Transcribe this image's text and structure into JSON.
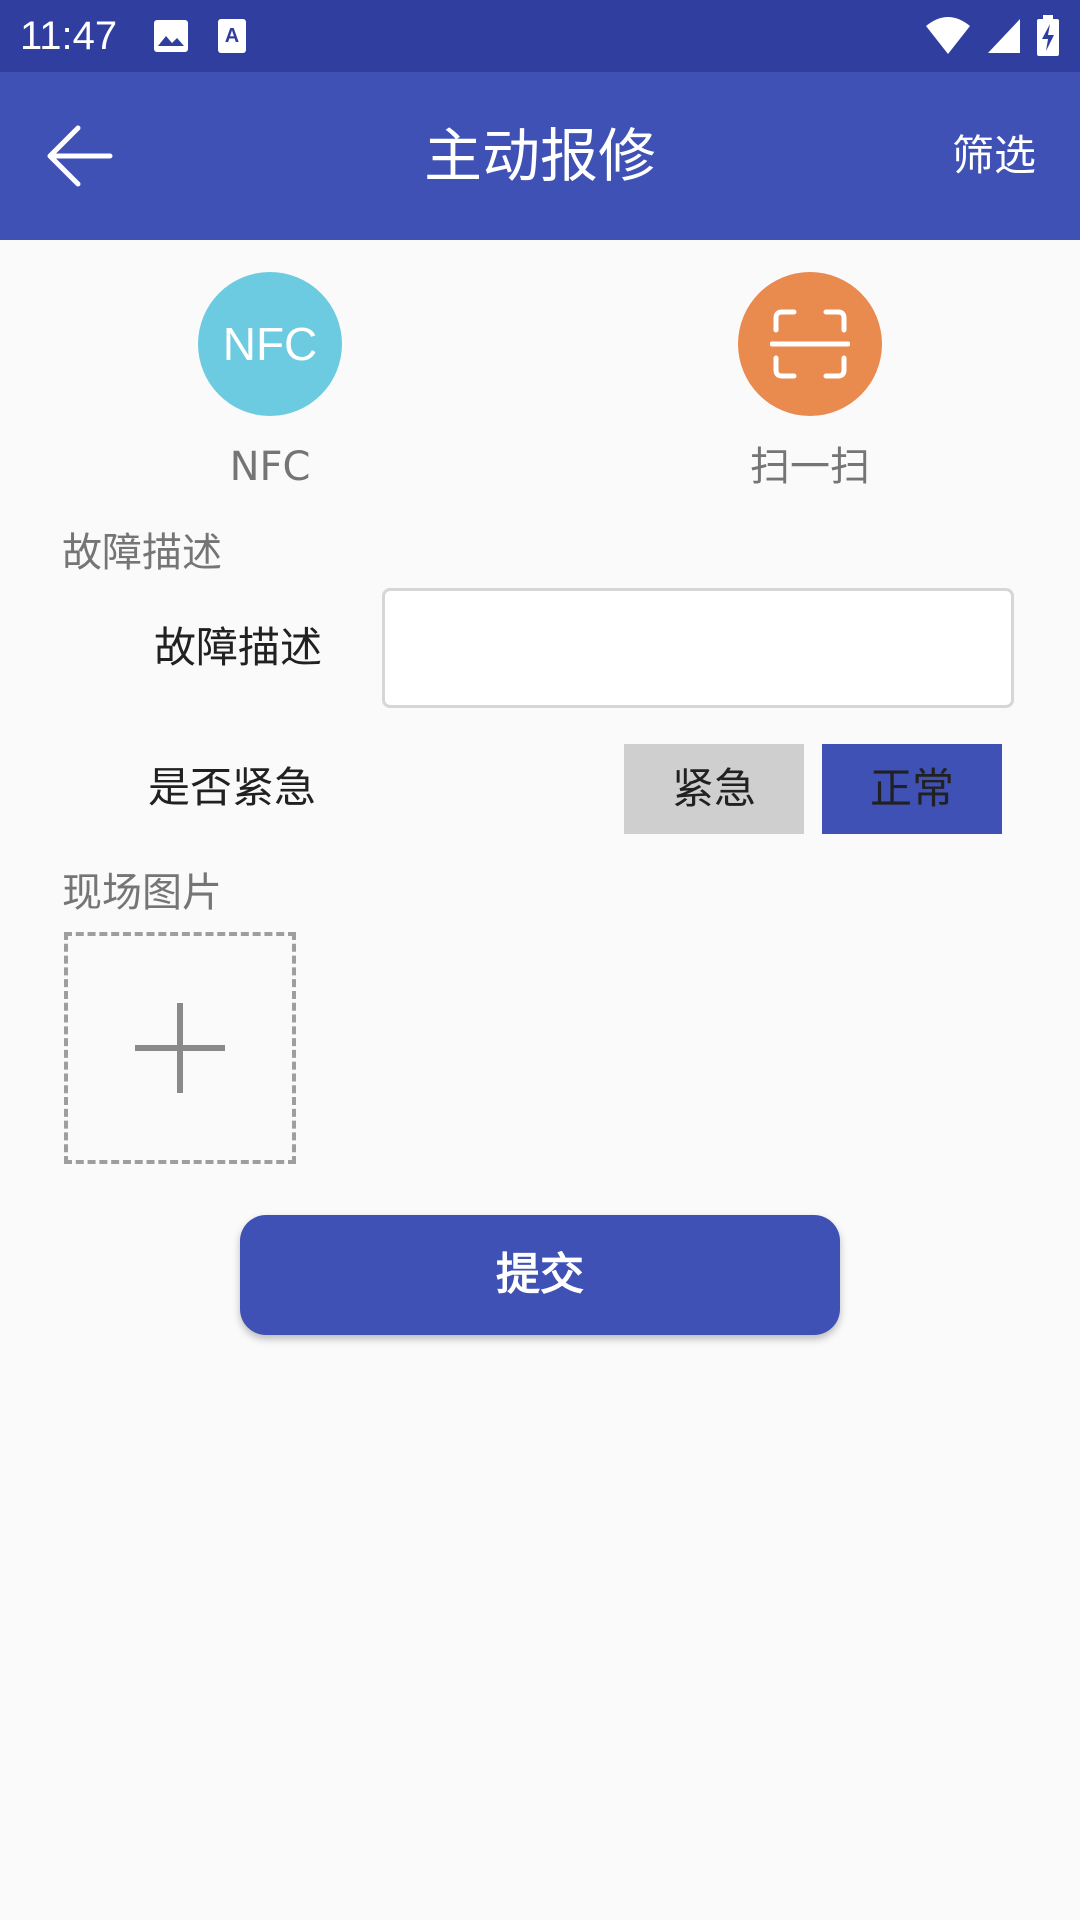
{
  "status_bar": {
    "time": "11:47",
    "icons": [
      "image-icon",
      "a-icon",
      "wifi-icon",
      "signal-icon",
      "battery-charging-icon"
    ]
  },
  "app_bar": {
    "title": "主动报修",
    "filter_label": "筛选",
    "back_icon": "arrow-left-icon"
  },
  "quick_actions": [
    {
      "label": "NFC",
      "icon_text": "NFC",
      "color": "#6ccbe0"
    },
    {
      "label": "扫一扫",
      "icon": "scan-icon",
      "color": "#e98a4f"
    }
  ],
  "fault_section": {
    "title": "故障描述",
    "field_label": "故障描述",
    "input_value": "",
    "urgency_label": "是否紧急",
    "urgency_options": [
      "紧急",
      "正常"
    ],
    "urgency_selected": "正常"
  },
  "photo_section": {
    "title": "现场图片",
    "add_icon": "plus-icon"
  },
  "submit_label": "提交",
  "colors": {
    "primary": "#3f51b5",
    "primary_dark": "#303f9f",
    "nfc": "#6ccbe0",
    "scan": "#e98a4f",
    "toggle_inactive": "#cfcfcf"
  }
}
